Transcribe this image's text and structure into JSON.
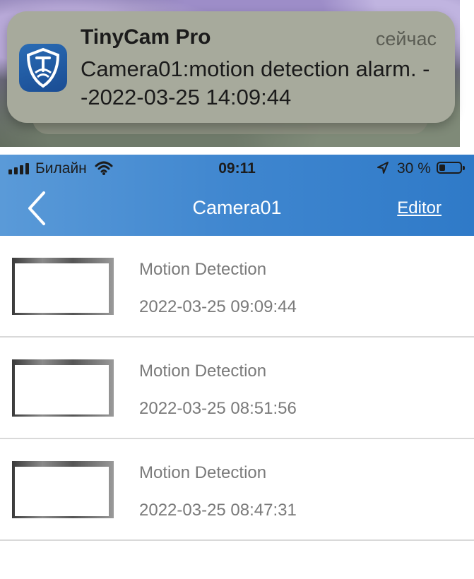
{
  "notification": {
    "app_name": "TinyCam Pro",
    "time": "сейчас",
    "message": "Camera01:motion detection alarm. --2022-03-25 14:09:44"
  },
  "status_bar": {
    "carrier": "Билайн",
    "time": "09:11",
    "battery": "30 %"
  },
  "header": {
    "title": "Camera01",
    "edit_label": "Editor",
    "background_color": "#3f86cf"
  },
  "events": [
    {
      "type": "Motion Detection",
      "timestamp": "2022-03-25 09:09:44"
    },
    {
      "type": "Motion Detection",
      "timestamp": "2022-03-25 08:51:56"
    },
    {
      "type": "Motion Detection",
      "timestamp": "2022-03-25 08:47:31"
    }
  ],
  "icons": {
    "app_icon": "tinycam-shield-icon",
    "back": "chevron-left-icon",
    "wifi": "wifi-icon",
    "location": "location-arrow-icon",
    "battery": "battery-icon",
    "signal": "cellular-signal-icon"
  }
}
